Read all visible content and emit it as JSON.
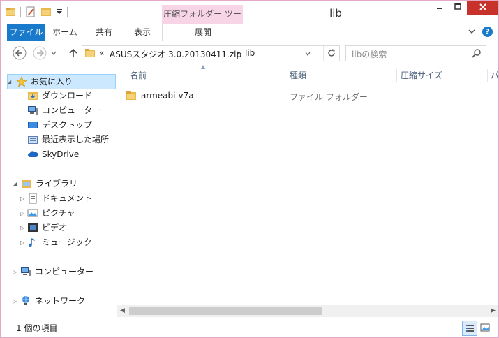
{
  "window": {
    "title": "lib"
  },
  "context_tab": {
    "label": "圧縮フォルダー ツール"
  },
  "ribbon": {
    "file": "ファイル",
    "home": "ホーム",
    "share": "共有",
    "view": "表示",
    "extract": "展開",
    "help": "?"
  },
  "address": {
    "overflow": "«",
    "crumb1": "ASUSスタジオ 3.0.20130411.zip",
    "sep": "›",
    "crumb2": "lib"
  },
  "search": {
    "placeholder": "libの検索"
  },
  "nav": {
    "favorites": "お気に入り",
    "downloads": "ダウンロード",
    "computer1": "コンピューター",
    "desktop": "デスクトップ",
    "recent": "最近表示した場所",
    "skydrive": "SkyDrive",
    "libraries": "ライブラリ",
    "documents": "ドキュメント",
    "pictures": "ピクチャ",
    "videos": "ビデオ",
    "music": "ミュージック",
    "computer2": "コンピューター",
    "network": "ネットワーク"
  },
  "columns": {
    "name": "名前",
    "type": "種類",
    "size": "圧縮サイズ",
    "more": "パ"
  },
  "files": [
    {
      "name": "armeabi-v7a",
      "type": "ファイル フォルダー"
    }
  ],
  "status": {
    "count": "1 個の項目"
  },
  "colors": {
    "accent": "#1979ca",
    "context": "#f7d4e6",
    "close": "#c7332b",
    "selected": "#cce8ff"
  }
}
